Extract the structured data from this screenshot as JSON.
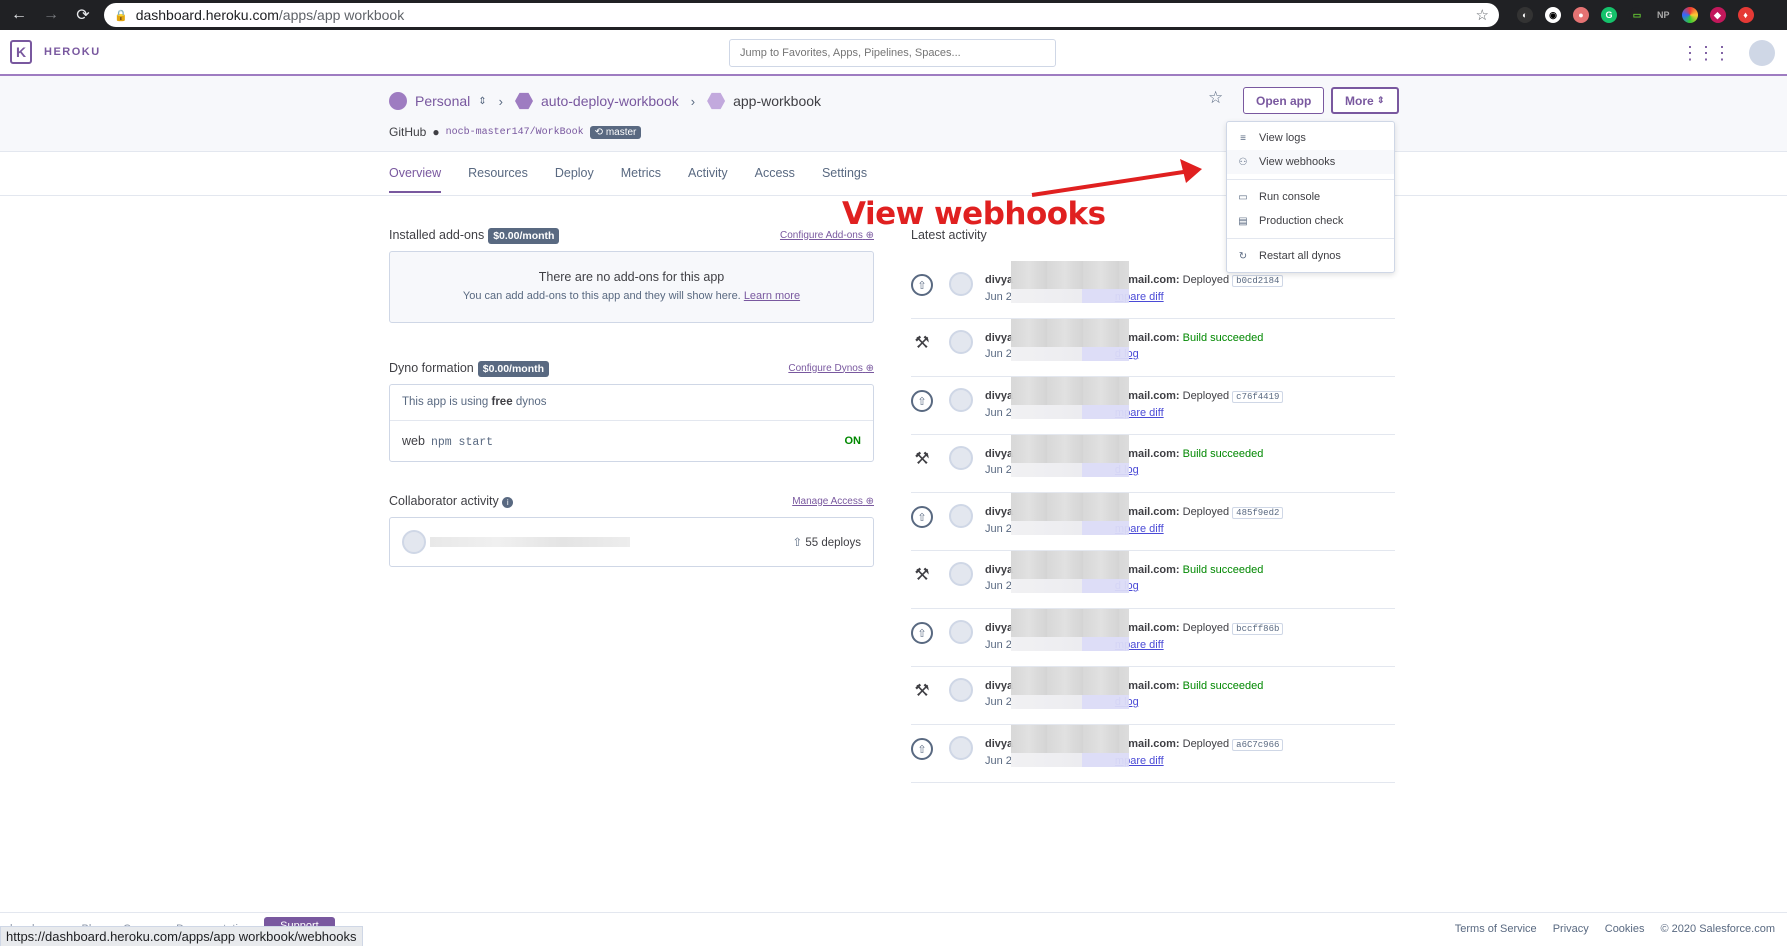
{
  "browser": {
    "url_host": "dashboard.heroku.com",
    "url_path": "/apps/app workbook",
    "status_url": "https://dashboard.heroku.com/apps/app workbook/webhooks",
    "ext_np": "NP"
  },
  "header": {
    "brand": "HEROKU",
    "search_placeholder": "Jump to Favorites, Apps, Pipelines, Spaces..."
  },
  "breadcrumb": {
    "team": "Personal",
    "pipeline": "auto-deploy-workbook",
    "app": "app-workbook"
  },
  "github": {
    "label": "GitHub",
    "repo": "nocb-master147/WorkBook",
    "branch": "master"
  },
  "actions": {
    "open_app": "Open app",
    "more": "More"
  },
  "tabs": [
    "Overview",
    "Resources",
    "Deploy",
    "Metrics",
    "Activity",
    "Access",
    "Settings"
  ],
  "more_menu": {
    "view_logs": "View logs",
    "view_webhooks": "View webhooks",
    "run_console": "Run console",
    "production_check": "Production check",
    "restart_all_dynos": "Restart all dynos"
  },
  "annotation": "View webhooks",
  "addons": {
    "title": "Installed add-ons",
    "price": "$0.00/month",
    "configure": "Configure Add-ons",
    "empty_title": "There are no add-ons for this app",
    "empty_text": "You can add add-ons to this app and they will show here.",
    "learn_more": "Learn more"
  },
  "dynos": {
    "title": "Dyno formation",
    "price": "$0.00/month",
    "configure": "Configure Dynos",
    "using_prefix": "This app is using",
    "using_type": "free",
    "using_suffix": "dynos",
    "process": "web",
    "command": "npm start",
    "state": "ON"
  },
  "collaborators": {
    "title": "Collaborator activity",
    "manage": "Manage Access",
    "deploys": "55 deploys"
  },
  "activity": {
    "title": "Latest activity",
    "items": [
      {
        "kind": "deploy",
        "who": "divya",
        "email_tail": "mail.com:",
        "status": "Deployed",
        "sha": "b0cd2184",
        "date": "Jun 2",
        "link": "mpare diff"
      },
      {
        "kind": "build",
        "who": "divya",
        "email_tail": "mail.com:",
        "status": "Build succeeded",
        "sha": "",
        "date": "Jun 2",
        "link": "d log"
      },
      {
        "kind": "deploy",
        "who": "divya",
        "email_tail": "mail.com:",
        "status": "Deployed",
        "sha": "c76f4419",
        "date": "Jun 2",
        "link": "mpare diff"
      },
      {
        "kind": "build",
        "who": "divya",
        "email_tail": "mail.com:",
        "status": "Build succeeded",
        "sha": "",
        "date": "Jun 2",
        "link": "d log"
      },
      {
        "kind": "deploy",
        "who": "divya",
        "email_tail": "mail.com:",
        "status": "Deployed",
        "sha": "485f9ed2",
        "date": "Jun 2",
        "link": "mpare diff"
      },
      {
        "kind": "build",
        "who": "divya",
        "email_tail": "mail.com:",
        "status": "Build succeeded",
        "sha": "",
        "date": "Jun 2",
        "link": "d log"
      },
      {
        "kind": "deploy",
        "who": "divya",
        "email_tail": "mail.com:",
        "status": "Deployed",
        "sha": "bccff86b",
        "date": "Jun 2",
        "link": "mpare diff"
      },
      {
        "kind": "build",
        "who": "divya",
        "email_tail": "mail.com:",
        "status": "Build succeeded",
        "sha": "",
        "date": "Jun 2",
        "link": "d log"
      },
      {
        "kind": "deploy",
        "who": "divya",
        "email_tail": "mail.com:",
        "status": "Deployed",
        "sha": "a6C7c966",
        "date": "Jun 2",
        "link": "mpare diff"
      }
    ]
  },
  "footer": {
    "left": [
      "heroku.com",
      "Blogs",
      "Careers",
      "Documentation"
    ],
    "support": "Support",
    "links": [
      "Terms of Service",
      "Privacy",
      "Cookies",
      "© 2020 Salesforce.com"
    ]
  },
  "colors": {
    "brand": "#79589f",
    "success": "#008800",
    "annotation": "#e02020"
  }
}
